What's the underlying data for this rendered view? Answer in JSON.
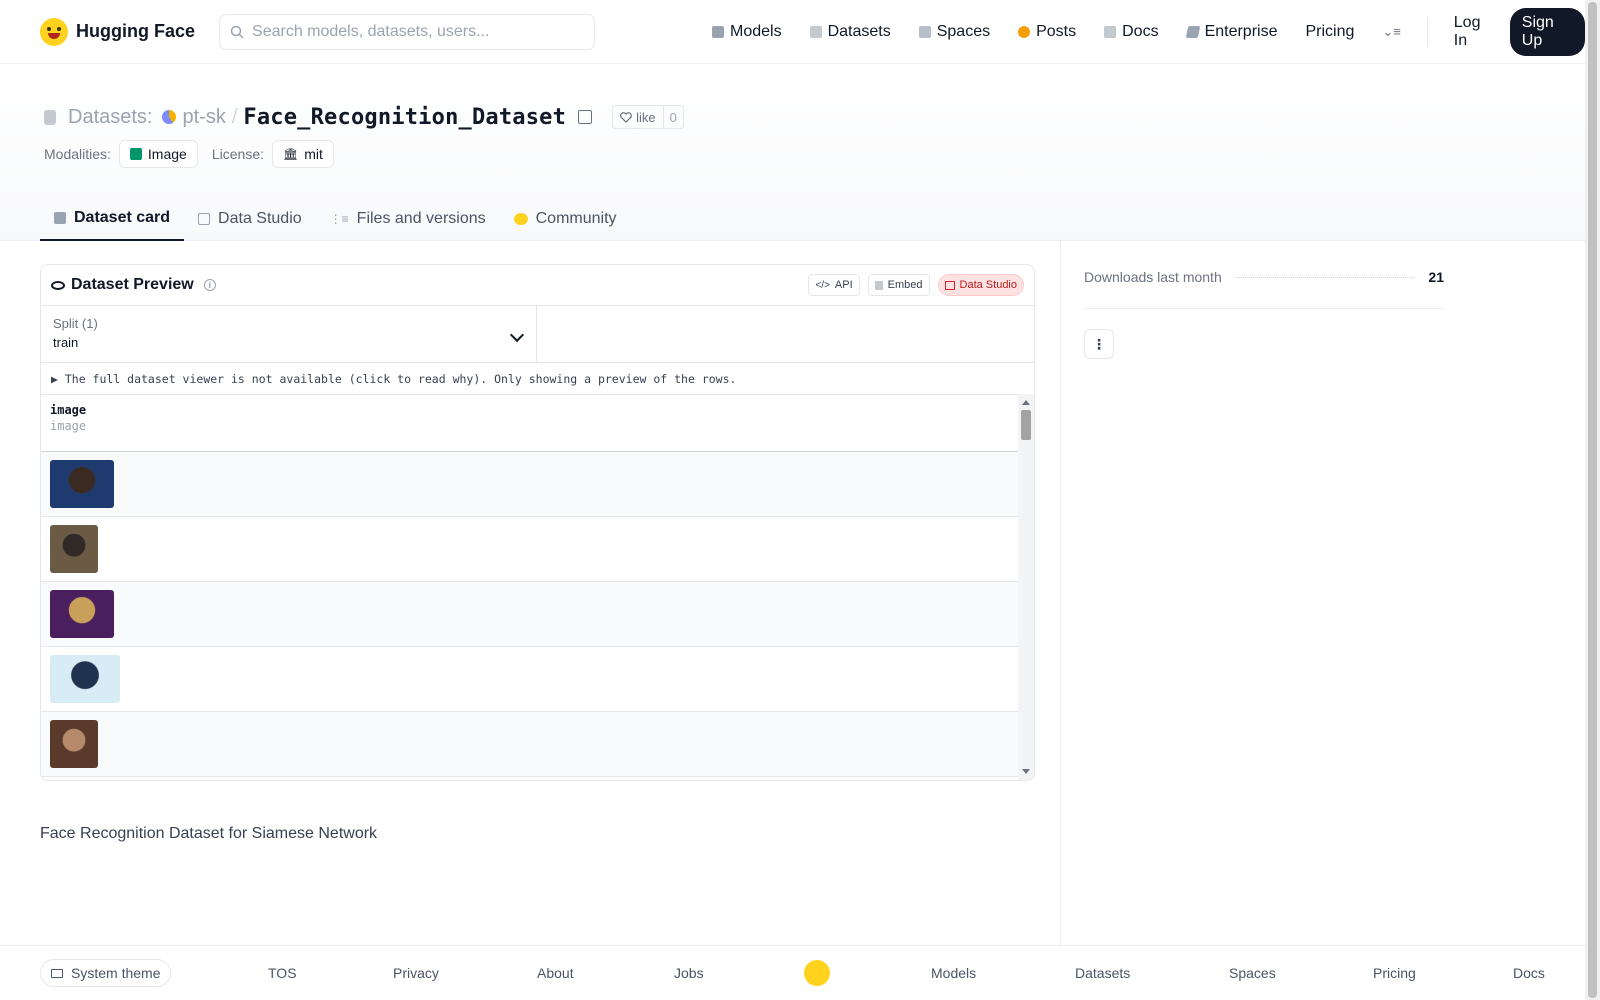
{
  "nav": {
    "brand": "Hugging Face",
    "search_placeholder": "Search models, datasets, users...",
    "links": [
      {
        "label": "Models",
        "color": "#6b7280"
      },
      {
        "label": "Datasets",
        "color": "#9ca3af"
      },
      {
        "label": "Spaces",
        "color": "#9ca3af"
      },
      {
        "label": "Posts",
        "color": "#f59e0b"
      },
      {
        "label": "Docs",
        "color": "#9ca3af"
      },
      {
        "label": "Enterprise",
        "color": "#6b7280"
      },
      {
        "label": "Pricing"
      }
    ],
    "login": "Log In",
    "signup": "Sign Up"
  },
  "header": {
    "crumb_label": "Datasets:",
    "owner": "pt-sk",
    "separator": "/",
    "dataset_name": "Face_Recognition_Dataset",
    "like_label": "like",
    "like_count": "0",
    "modalities_label": "Modalities:",
    "modality": "Image",
    "license_label": "License:",
    "license": "mit"
  },
  "tabs": [
    {
      "label": "Dataset card",
      "active": true
    },
    {
      "label": "Data Studio"
    },
    {
      "label": "Files and versions"
    },
    {
      "label": "Community"
    }
  ],
  "preview": {
    "title": "Dataset Preview",
    "api_label": "API",
    "embed_label": "Embed",
    "studio_label": "Data Studio",
    "split_label": "Split (1)",
    "split_value": "train",
    "notice": "▶ The full dataset viewer is not available (click to read why). Only showing a preview of the rows.",
    "column_name": "image",
    "column_type": "image",
    "rows": [
      {
        "thumb_colors": [
          "#1e3a6e",
          "#3a2a22"
        ]
      },
      {
        "thumb_colors": [
          "#6b5a44",
          "#2f2a26"
        ]
      },
      {
        "thumb_colors": [
          "#4a1f5e",
          "#c9a05a"
        ]
      },
      {
        "thumb_colors": [
          "#d7ecf4",
          "#1f3350"
        ]
      },
      {
        "thumb_colors": [
          "#5a3a2a",
          "#b58a6a"
        ]
      }
    ]
  },
  "description": "Face Recognition Dataset for Siamese Network",
  "sidebar": {
    "downloads_label": "Downloads last month",
    "downloads_value": "21"
  },
  "footer": {
    "theme": "System theme",
    "links": [
      "TOS",
      "Privacy",
      "About",
      "Jobs",
      "Models",
      "Datasets",
      "Spaces",
      "Pricing",
      "Docs"
    ]
  }
}
